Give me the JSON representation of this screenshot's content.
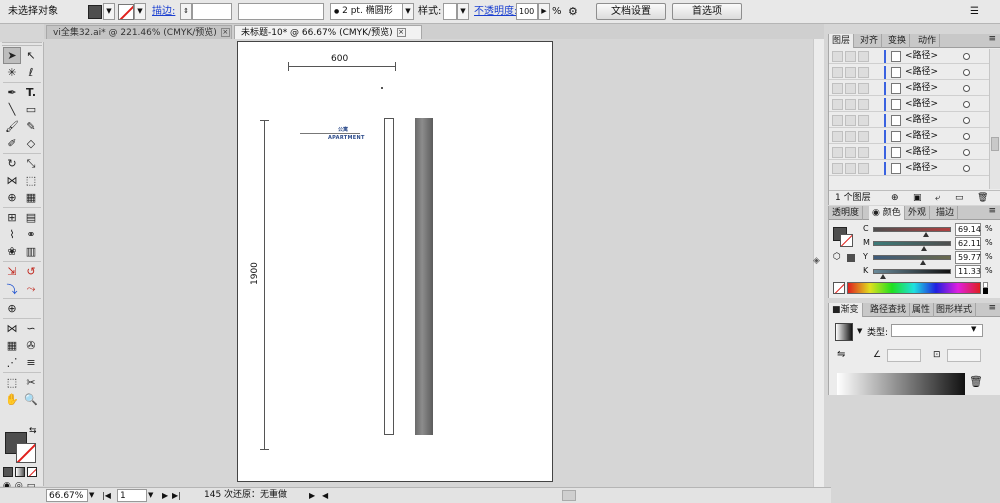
{
  "control_bar": {
    "selection_status": "未选择对象",
    "stroke_label": "描边:",
    "stroke_weight": "2 pt.",
    "brush_name": "椭圆形",
    "style_label": "样式:",
    "opacity_label": "不透明度:",
    "opacity_value": "100",
    "opacity_unit": "%",
    "doc_setup_button": "文档设置",
    "preferences_button": "首选项"
  },
  "tabs": [
    {
      "label": "vi全集32.ai* @ 221.46% (CMYK/预览)"
    },
    {
      "label": "未标题-10* @ 66.67% (CMYK/预览)"
    }
  ],
  "artboard": {
    "dimension_top": "600",
    "dimension_side": "1900",
    "logo_cn": "公寓",
    "logo_en": "APARTMENT"
  },
  "status_bar": {
    "zoom": "66.67%",
    "page": "1",
    "history": "145 次还原：无重做"
  },
  "layers_panel": {
    "tabs": [
      "图层",
      "对齐",
      "变换",
      "动作"
    ],
    "items": [
      "<路径>",
      "<路径>",
      "<路径>",
      "<路径>",
      "<路径>",
      "<路径>",
      "<路径>",
      "<路径>"
    ],
    "count": "1 个图层"
  },
  "color_panel": {
    "tabs": [
      "透明度",
      "颜色",
      "外观",
      "描边"
    ],
    "channels": [
      {
        "name": "C",
        "value": "69.14",
        "unit": "%"
      },
      {
        "name": "M",
        "value": "62.11",
        "unit": "%"
      },
      {
        "name": "Y",
        "value": "59.77",
        "unit": "%"
      },
      {
        "name": "K",
        "value": "11.33",
        "unit": "%"
      }
    ]
  },
  "gradient_panel": {
    "tabs": [
      "渐变",
      "路径查找",
      "属性",
      "图形样式"
    ],
    "type_label": "类型:"
  },
  "colors": {
    "fill": "#4e4e4e",
    "layer_bar": "#3a62e0",
    "logo_blue": "#2b4a8a"
  },
  "icons": [
    "selection-tool",
    "direct-selection-tool",
    "magic-wand-tool",
    "lasso-tool",
    "pen-tool",
    "type-tool",
    "line-tool",
    "rectangle-tool",
    "paintbrush-tool",
    "pencil-tool",
    "blob-brush-tool",
    "eraser-tool",
    "rotate-tool",
    "scale-tool",
    "width-tool",
    "free-transform-tool",
    "shape-builder-tool",
    "perspective-grid-tool",
    "mesh-tool",
    "gradient-tool",
    "eyedropper-tool",
    "blend-tool",
    "symbol-sprayer-tool",
    "column-graph-tool",
    "artboard-tool",
    "slice-tool",
    "hand-tool",
    "zoom-tool"
  ]
}
